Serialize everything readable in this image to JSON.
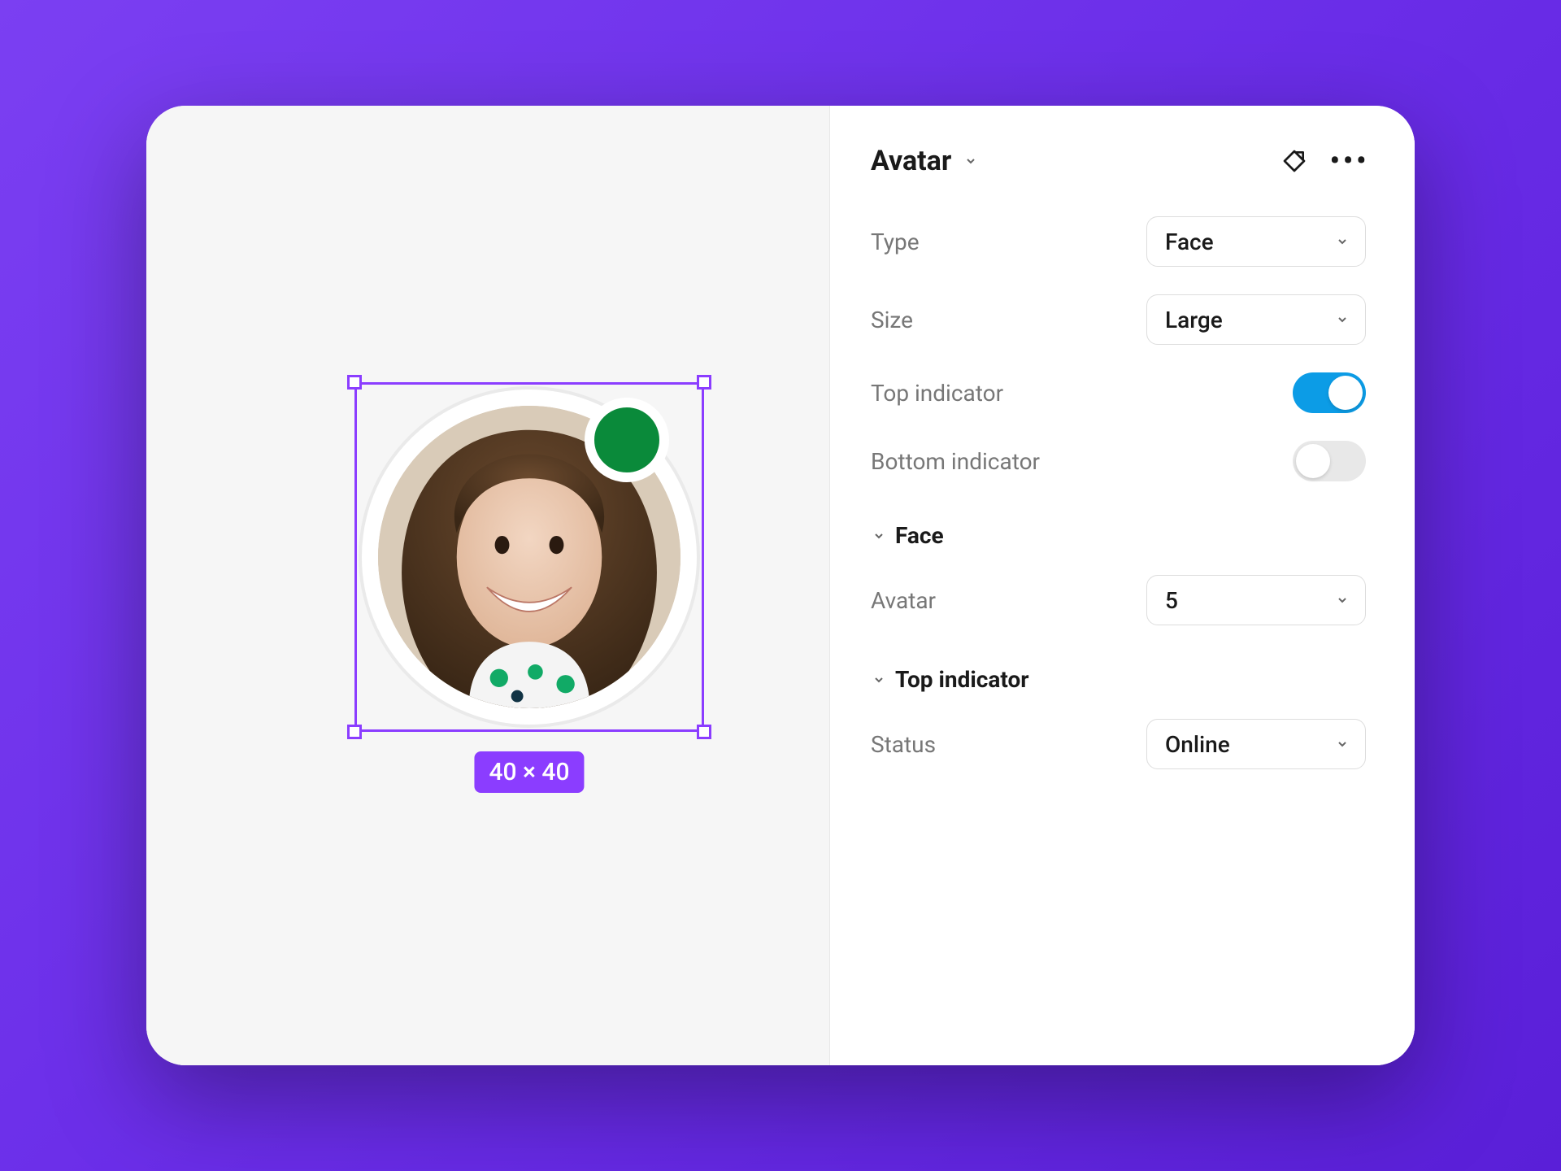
{
  "panel": {
    "title": "Avatar",
    "sections": {
      "main": {
        "type_label": "Type",
        "type_value": "Face",
        "size_label": "Size",
        "size_value": "Large",
        "top_indicator_label": "Top indicator",
        "top_indicator_on": true,
        "bottom_indicator_label": "Bottom indicator",
        "bottom_indicator_on": false
      },
      "face": {
        "title": "Face",
        "avatar_label": "Avatar",
        "avatar_value": "5"
      },
      "top_indicator": {
        "title": "Top indicator",
        "status_label": "Status",
        "status_value": "Online"
      }
    }
  },
  "canvas": {
    "dimensions_label": "40 × 40",
    "status_color": "#0a8a3a",
    "selection_color": "#8b3dff"
  }
}
